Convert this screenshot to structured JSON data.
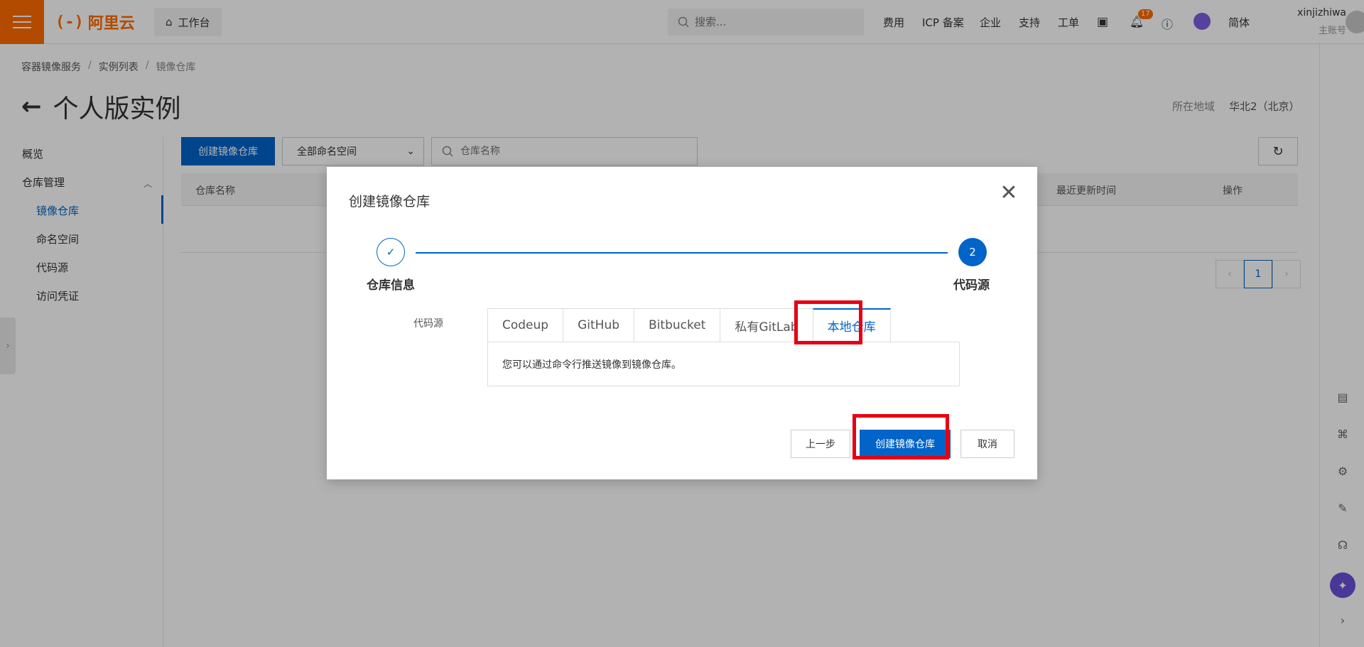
{
  "topbar": {
    "logo_text": "阿里云",
    "workbench_label": "工作台",
    "search_placeholder": "搜索...",
    "nav": [
      "费用",
      "ICP 备案",
      "企业",
      "支持",
      "工单"
    ],
    "notification_count": "17",
    "language": "简体",
    "user_name": "xinjizhiwa",
    "user_role": "主账号"
  },
  "breadcrumb": [
    "容器镜像服务",
    "实例列表",
    "镜像仓库"
  ],
  "page": {
    "title": "个人版实例",
    "region_label": "所在地域",
    "region_value": "华北2（北京）"
  },
  "sidebar": {
    "overview": "概览",
    "group": "仓库管理",
    "items": [
      "镜像仓库",
      "命名空间",
      "代码源",
      "访问凭证"
    ]
  },
  "toolbar": {
    "create_label": "创建镜像仓库",
    "namespace_select": "全部命名空间",
    "search_placeholder": "仓库名称"
  },
  "table": {
    "columns": [
      "仓库名称",
      "最近更新时间",
      "操作"
    ]
  },
  "pager": {
    "current": "1"
  },
  "modal": {
    "title": "创建镜像仓库",
    "steps": [
      {
        "label": "仓库信息",
        "status": "done"
      },
      {
        "number": "2",
        "label": "代码源",
        "status": "active"
      }
    ],
    "field_label": "代码源",
    "tabs": [
      "Codeup",
      "GitHub",
      "Bitbucket",
      "私有GitLab",
      "本地仓库"
    ],
    "active_tab": "本地仓库",
    "panel_text": "您可以通过命令行推送镜像到镜像仓库。",
    "prev_label": "上一步",
    "create_label": "创建镜像仓库",
    "cancel_label": "取消"
  },
  "colors": {
    "brand": "#ff6a00",
    "primary": "#0064c8",
    "highlight": "#e60012"
  }
}
